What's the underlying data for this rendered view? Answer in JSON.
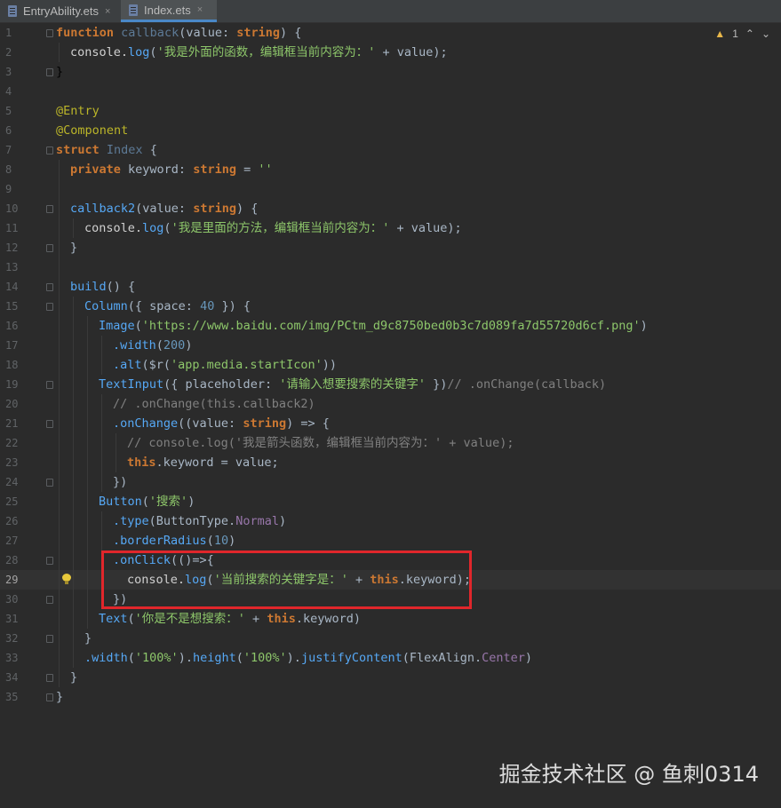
{
  "tabs": [
    {
      "label": "EntryAbility.ets",
      "close": "×"
    },
    {
      "label": "Index.ets",
      "close": "×"
    }
  ],
  "inspection": {
    "warning_icon": "warning-icon",
    "count": "1",
    "up": "⌃",
    "down": "⌄"
  },
  "line_numbers": [
    "1",
    "2",
    "3",
    "4",
    "5",
    "6",
    "7",
    "8",
    "9",
    "10",
    "11",
    "12",
    "13",
    "14",
    "15",
    "16",
    "17",
    "18",
    "19",
    "20",
    "21",
    "22",
    "23",
    "24",
    "25",
    "26",
    "27",
    "28",
    "29",
    "30",
    "31",
    "32",
    "33",
    "34",
    "35"
  ],
  "code": {
    "l1": {
      "kw": "function",
      "name": "callback",
      "p1": "(value: ",
      "type": "string",
      "p2": ") {"
    },
    "l2": {
      "a": "console.",
      "b": "log",
      "c": "(",
      "s": "'我是外面的函数，编辑框当前内容为：'",
      "d": " + value);"
    },
    "l3": "}",
    "l5": "@Entry",
    "l6": "@Component",
    "l7": {
      "kw": "struct",
      "name": "Index",
      "b": " {"
    },
    "l8": {
      "kw": "private",
      "a": " keyword: ",
      "type": "string",
      "b": " = ",
      "s": "''"
    },
    "l10": {
      "a": "callback2",
      "b": "(value: ",
      "type": "string",
      "c": ") {"
    },
    "l11": {
      "a": "console.",
      "b": "log",
      "c": "(",
      "s": "'我是里面的方法，编辑框当前内容为：'",
      "d": " + value);"
    },
    "l12": "}",
    "l14": {
      "a": "build",
      "b": "() {"
    },
    "l15": {
      "a": "Column",
      "b": "({ space: ",
      "n": "40",
      "c": " }) {"
    },
    "l16": {
      "a": "Image",
      "b": "(",
      "s": "'https://www.baidu.com/img/PCtm_d9c8750bed0b3c7d089fa7d55720d6cf.png'",
      "c": ")"
    },
    "l17": {
      "a": ".width",
      "b": "(",
      "n": "200",
      "c": ")"
    },
    "l18": {
      "a": ".alt",
      "b": "($r(",
      "s": "'app.media.startIcon'",
      "c": "))"
    },
    "l19": {
      "a": "TextInput",
      "b": "({ placeholder: ",
      "s": "'请输入想要搜索的关键字'",
      "c": " })",
      "cm": "// .onChange(callback)"
    },
    "l20": "// .onChange(this.callback2)",
    "l21": {
      "a": ".onChange",
      "b": "((value: ",
      "type": "string",
      "c": ") => {"
    },
    "l22": "// console.log('我是箭头函数，编辑框当前内容为：' + value);",
    "l23": {
      "kw": "this",
      "a": ".keyword = value;"
    },
    "l24": "})",
    "l25": {
      "a": "Button",
      "b": "(",
      "s": "'搜索'",
      "c": ")"
    },
    "l26": {
      "a": ".type",
      "b": "(ButtonType.",
      "c": "Normal",
      ",d": ")",
      "d": ")"
    },
    "l27": {
      "a": ".borderRadius",
      "b": "(",
      "n": "10",
      "c": ")"
    },
    "l28": {
      "a": ".onClick",
      "b": "(()=>{"
    },
    "l29": {
      "a": "console.",
      "b": "log",
      "c": "(",
      "s": "'当前搜索的关键字是：'",
      "d": " + ",
      "kw": "this",
      "e": ".keyword);"
    },
    "l30": "})",
    "l31": {
      "a": "Text",
      "b": "(",
      "s": "'你是不是想搜索：'",
      "c": " + ",
      "kw": "this",
      "d": ".keyword)"
    },
    "l32": "}",
    "l33": {
      "a": ".width",
      "b": "(",
      "s1": "'100%'",
      "c": ").",
      "d": "height",
      "e": "(",
      "s2": "'100%'",
      "f": ").",
      "g": "justifyContent",
      "h": "(FlexAlign.",
      "i": "Center",
      "j": ")"
    },
    "l34": "}",
    "l35": "}"
  },
  "watermark": "掘金技术社区 @ 鱼刺0314"
}
